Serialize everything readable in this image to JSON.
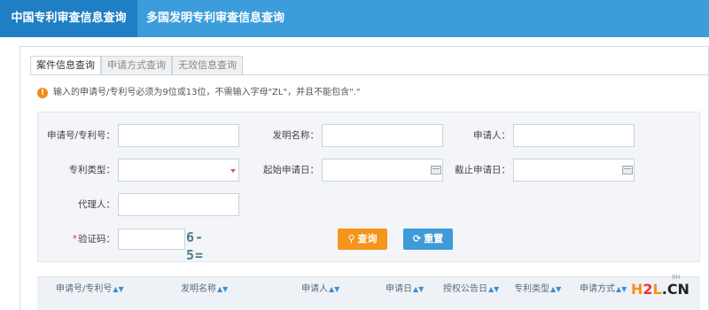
{
  "topnav": {
    "tab_cn": "中国专利审查信息查询",
    "tab_multi": "多国发明专利审查信息查询"
  },
  "subtabs": {
    "case": "案件信息查询",
    "method": "申请方式查询",
    "invalid": "无效信息查询"
  },
  "notice": "输入的申请号/专利号必须为9位或13位，不需输入字母\"ZL\"，并且不能包含\".\"",
  "form": {
    "app_no_label": "申请号/专利号：",
    "invention_name_label": "发明名称：",
    "applicant_label": "申请人：",
    "patent_type_label": "专利类型：",
    "start_date_label": "起始申请日：",
    "end_date_label": "截止申请日：",
    "agent_label": "代理人：",
    "captcha_label": "验证码：",
    "captcha_required": "*",
    "captcha_image_text": "6-5="
  },
  "buttons": {
    "search": "查询",
    "reset": "重置"
  },
  "results": {
    "columns": [
      "申请号/专利号",
      "发明名称",
      "申请人",
      "申请日",
      "授权公告日",
      "专利类型",
      "申请方式"
    ]
  },
  "watermark": {
    "part1": "H",
    "part2": "2",
    "part3": "L",
    "part4": ".CN",
    "small": "8H"
  },
  "colors": {
    "nav_bg": "#3c9ddc",
    "nav_active": "#1f7fc4",
    "search_btn": "#f5951b",
    "reset_btn": "#3f9ad8",
    "warn": "#f08c1e"
  }
}
